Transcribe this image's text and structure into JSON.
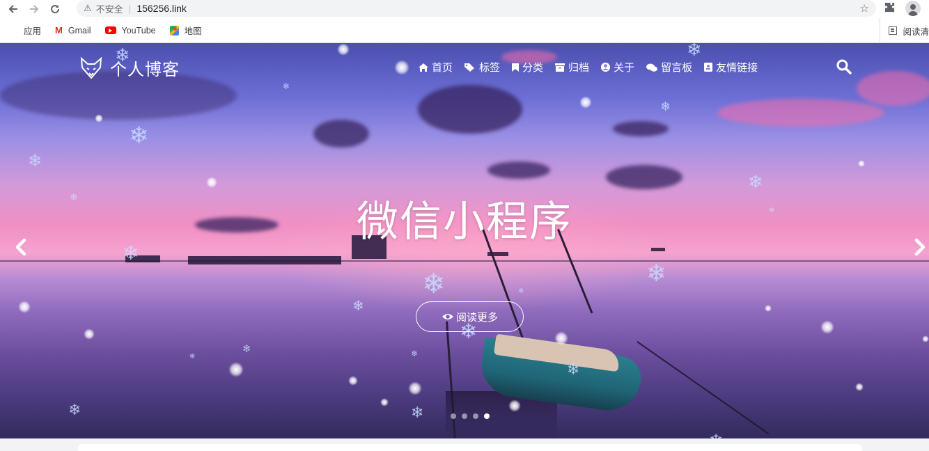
{
  "browser": {
    "security_label": "不安全",
    "url": "156256.link",
    "icons": {
      "back": "arrow-left-icon",
      "forward": "arrow-right-icon",
      "reload": "reload-icon",
      "star": "star-icon",
      "extensions": "puzzle-icon",
      "profile": "avatar-icon"
    }
  },
  "bookmarks": {
    "items": [
      {
        "label": "应用",
        "icon": "apps-grid-icon"
      },
      {
        "label": "Gmail",
        "icon": "gmail-icon"
      },
      {
        "label": "YouTube",
        "icon": "youtube-icon"
      },
      {
        "label": "地图",
        "icon": "maps-icon"
      }
    ],
    "reading_list": "阅读清"
  },
  "site": {
    "brand": "个人博客",
    "nav": [
      {
        "label": "首页",
        "icon": "home-icon"
      },
      {
        "label": "标签",
        "icon": "tags-icon"
      },
      {
        "label": "分类",
        "icon": "bookmark-icon"
      },
      {
        "label": "归档",
        "icon": "archive-icon"
      },
      {
        "label": "关于",
        "icon": "user-circle-icon"
      },
      {
        "label": "留言板",
        "icon": "comments-icon"
      },
      {
        "label": "友情链接",
        "icon": "address-card-icon"
      }
    ],
    "hero": {
      "title": "微信小程序",
      "button": "阅读更多",
      "slides": 4,
      "active_slide": 4
    },
    "colors": {
      "accent": "#ffffff",
      "sky_top": "#4b4fae",
      "sky_pink": "#f08fc3",
      "boat": "#2a7f8f"
    }
  }
}
